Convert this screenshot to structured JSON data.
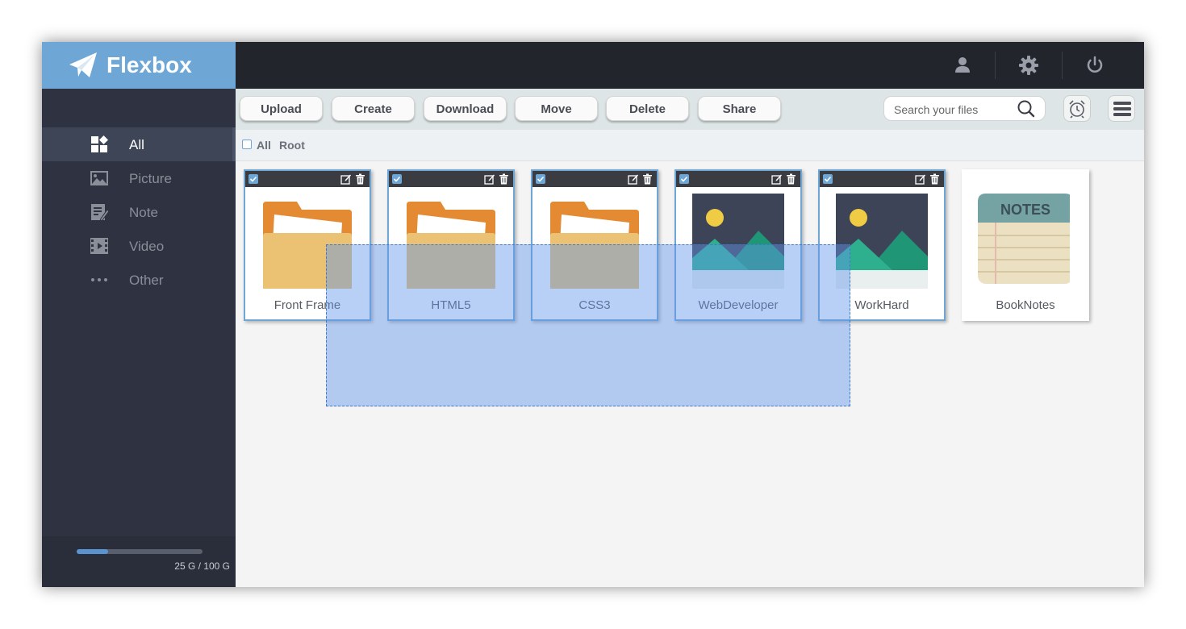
{
  "app": {
    "name": "Flexbox"
  },
  "sidebar": {
    "items": [
      {
        "label": "All",
        "icon": "grid-icon",
        "active": true
      },
      {
        "label": "Picture",
        "icon": "picture-icon",
        "active": false
      },
      {
        "label": "Note",
        "icon": "note-icon",
        "active": false
      },
      {
        "label": "Video",
        "icon": "video-icon",
        "active": false
      },
      {
        "label": "Other",
        "icon": "more-icon",
        "active": false
      }
    ],
    "storage": {
      "used_fraction": 0.25,
      "label": "25 G / 100 G"
    }
  },
  "topbar": {
    "icons": [
      "user-icon",
      "gear-icon",
      "power-icon"
    ]
  },
  "toolbar": {
    "upload": "Upload",
    "create": "Create",
    "download": "Download",
    "move": "Move",
    "delete": "Delete",
    "share": "Share",
    "search_placeholder": "Search your files"
  },
  "breadcrumb": {
    "all_label": "All",
    "root_label": "Root"
  },
  "files": [
    {
      "name": "Front Frame",
      "type": "folder",
      "selected": true
    },
    {
      "name": "HTML5",
      "type": "folder",
      "selected": true
    },
    {
      "name": "CSS3",
      "type": "folder",
      "selected": true
    },
    {
      "name": "WebDeveloper",
      "type": "picture",
      "selected": true
    },
    {
      "name": "WorkHard",
      "type": "picture",
      "selected": true
    },
    {
      "name": "BookNotes",
      "type": "note",
      "selected": false,
      "thumb_text": "NOTES"
    }
  ],
  "colors": {
    "accent": "#6ea6d6",
    "sidebar": "#2f3341",
    "topbar": "#22252c",
    "selection": "#6496eb"
  }
}
